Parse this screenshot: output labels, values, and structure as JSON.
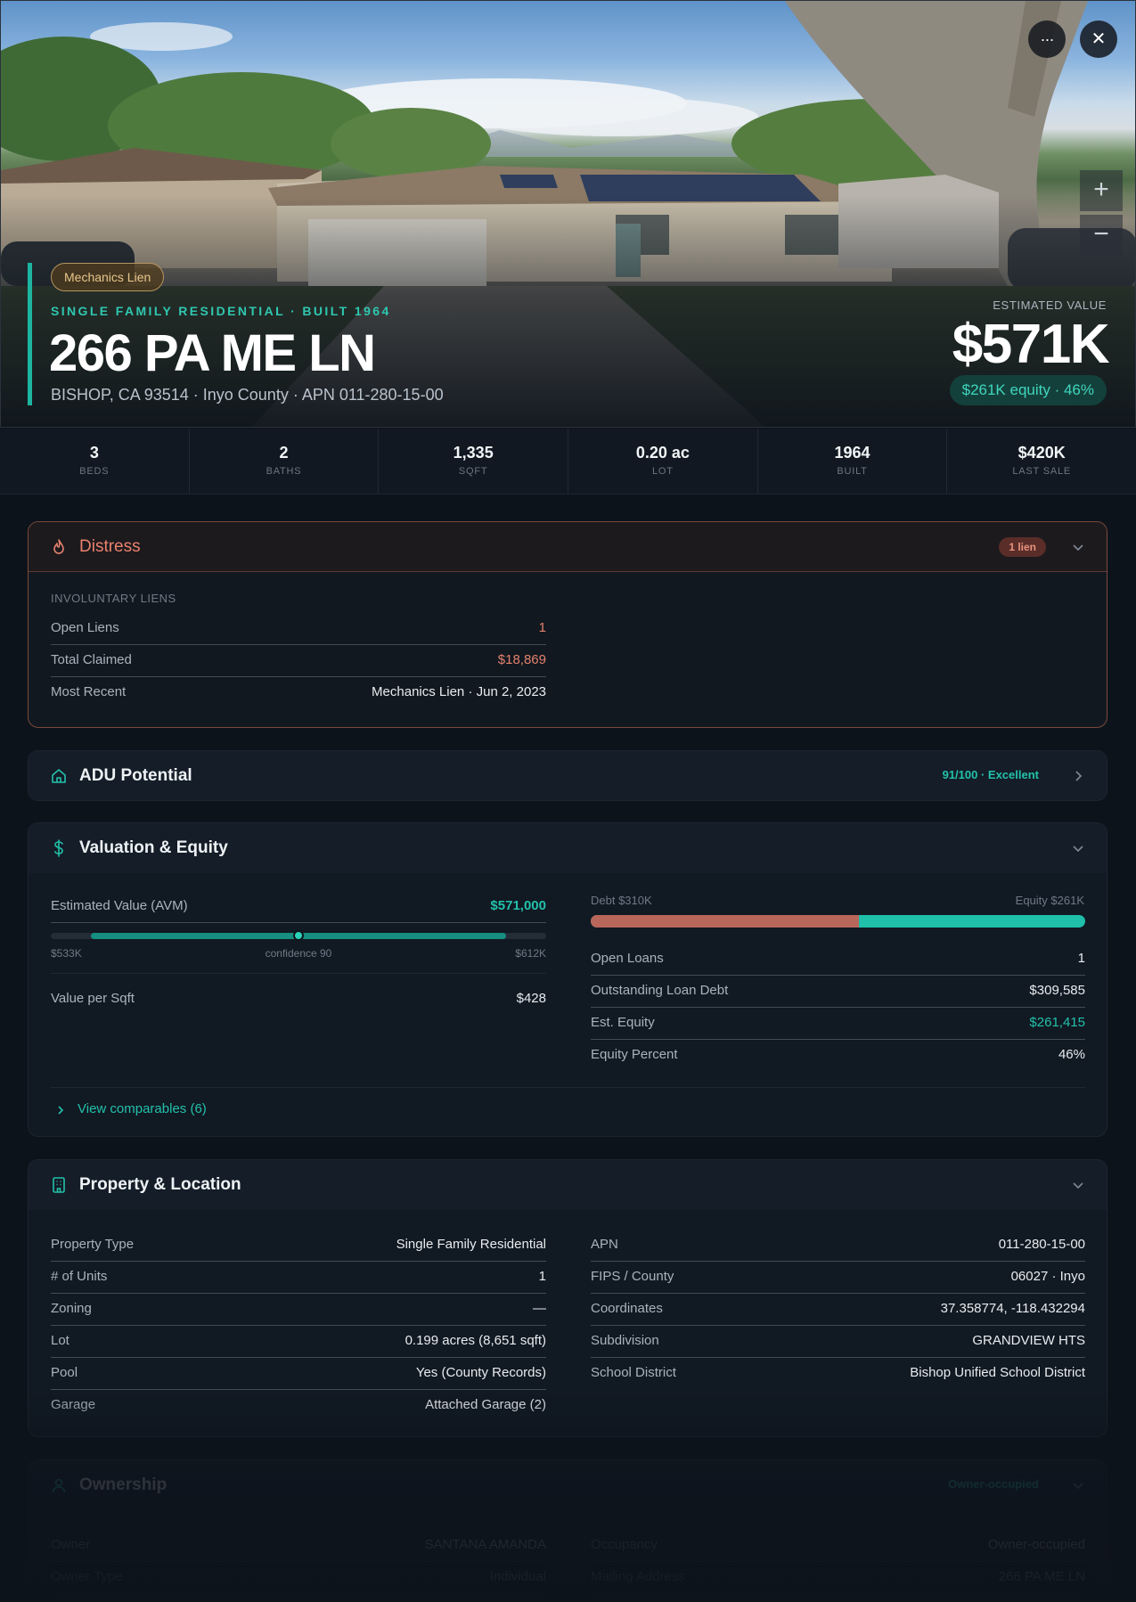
{
  "hero": {
    "badge": "Mechanics Lien",
    "subtitle": "SINGLE FAMILY RESIDENTIAL · BUILT 1964",
    "title": "266 PA ME LN",
    "address_line": "BISHOP, CA 93514 · Inyo County · APN 011-280-15-00",
    "estimated_label": "ESTIMATED VALUE",
    "estimated_value": "$571K",
    "equity_pill": "$261K equity · 46%",
    "more_icon_glyph": "···",
    "close_icon_glyph": "✕",
    "zoom_in_glyph": "+",
    "zoom_out_glyph": "−"
  },
  "stats": [
    {
      "value": "3",
      "label": "BEDS"
    },
    {
      "value": "2",
      "label": "BATHS"
    },
    {
      "value": "1,335",
      "label": "SQFT"
    },
    {
      "value": "0.20 ac",
      "label": "LOT"
    },
    {
      "value": "1964",
      "label": "BUILT"
    },
    {
      "value": "$420K",
      "label": "LAST SALE"
    }
  ],
  "distress": {
    "title": "Distress",
    "badge": "1 lien",
    "section_label": "INVOLUNTARY LIENS",
    "rows": [
      {
        "k": "Open Liens",
        "v": "1"
      },
      {
        "k": "Total Claimed",
        "v": "$18,869"
      },
      {
        "k": "Most Recent",
        "v": "Mechanics Lien · Jun 2, 2023"
      }
    ]
  },
  "adu": {
    "title": "ADU Potential",
    "score": "91/100 · Excellent"
  },
  "valuation": {
    "title": "Valuation & Equity",
    "avm_label": "Estimated Value (AVM)",
    "avm_value": "$571,000",
    "range_low": "$533K",
    "range_mid": "confidence 90",
    "range_high": "$612K",
    "value_per_sqft_label": "Value per Sqft",
    "value_per_sqft": "$428",
    "debt_label": "Debt $310K",
    "equity_label": "Equity $261K",
    "debt_fraction": 0.543,
    "rows": [
      {
        "k": "Open Loans",
        "v": "1"
      },
      {
        "k": "Outstanding Loan Debt",
        "v": "$309,585"
      },
      {
        "k": "Est. Equity",
        "v": "$261,415"
      },
      {
        "k": "Equity Percent",
        "v": "46%"
      }
    ],
    "comparables_link": "View comparables (6)"
  },
  "property": {
    "title": "Property & Location",
    "left": [
      {
        "k": "Property Type",
        "v": "Single Family Residential"
      },
      {
        "k": "# of Units",
        "v": "1"
      },
      {
        "k": "Zoning",
        "v": "—"
      },
      {
        "k": "Lot",
        "v": "0.199 acres (8,651 sqft)"
      },
      {
        "k": "Pool",
        "v": "Yes (County Records)"
      },
      {
        "k": "Garage",
        "v": "Attached Garage (2)"
      }
    ],
    "right": [
      {
        "k": "APN",
        "v": "011-280-15-00"
      },
      {
        "k": "FIPS / County",
        "v": "06027 · Inyo"
      },
      {
        "k": "Coordinates",
        "v": "37.358774, -118.432294"
      },
      {
        "k": "Subdivision",
        "v": "GRANDVIEW HTS"
      },
      {
        "k": "School District",
        "v": "Bishop Unified School District"
      }
    ]
  },
  "ownership": {
    "title": "Ownership",
    "badge": "Owner-occupied",
    "left": [
      {
        "k": "Owner",
        "v": "SANTANA AMANDA"
      },
      {
        "k": "Owner Type",
        "v": "Individual"
      }
    ],
    "right": [
      {
        "k": "Occupancy",
        "v": "Owner-occupied"
      },
      {
        "k": "Mailing Address",
        "v": "266 PA ME LN"
      }
    ]
  },
  "colors": {
    "accent_teal": "#23c1aa",
    "distress_salmon": "#e3826c",
    "debt_bar": "#b8665a",
    "equity_bar": "#1fbfaa",
    "background": "#0d131b"
  }
}
